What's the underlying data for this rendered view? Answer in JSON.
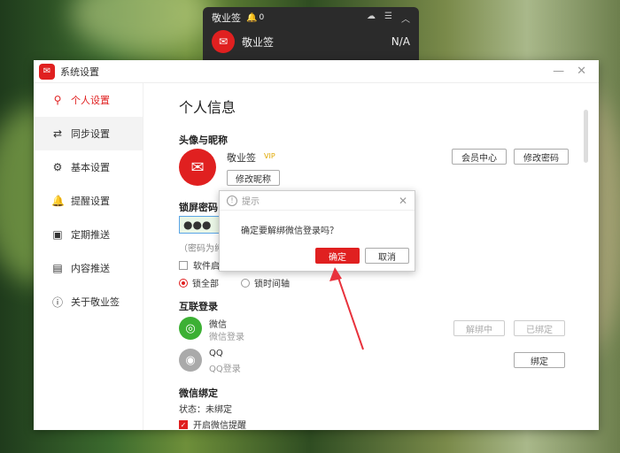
{
  "mini_widget": {
    "title": "敬业签",
    "bell_count": "0",
    "app_name": "敬业签",
    "value": "N/A"
  },
  "window": {
    "title": "系统设置"
  },
  "sidebar": {
    "items": [
      {
        "label": "个人设置",
        "icon": "person-icon"
      },
      {
        "label": "同步设置",
        "icon": "sync-icon"
      },
      {
        "label": "基本设置",
        "icon": "settings-icon"
      },
      {
        "label": "提醒设置",
        "icon": "bell-icon"
      },
      {
        "label": "定期推送",
        "icon": "calendar-icon"
      },
      {
        "label": "内容推送",
        "icon": "document-icon"
      },
      {
        "label": "关于敬业签",
        "icon": "info-icon"
      }
    ]
  },
  "content": {
    "heading": "个人信息",
    "avatar_section": "头像与昵称",
    "username": "敬业签",
    "vip": "VIP",
    "member_center": "会员中心",
    "change_password": "修改密码",
    "change_nickname": "修改昵称",
    "lock_section": "锁屏密码",
    "password_mask": "●●●",
    "password_hint": "（密码为纯",
    "software_start": "软件启",
    "lock_all": "锁全部",
    "lock_timeline": "锁时间轴",
    "interconnect_section": "互联登录",
    "wechat_name": "微信",
    "wechat_sub": "微信登录",
    "wechat_unbinding": "解绑中",
    "wechat_bound": "已绑定",
    "qq_name": "QQ",
    "qq_sub": "QQ登录",
    "qq_bind": "绑定",
    "wechat_bind_section": "微信绑定",
    "status": "状态：未绑定",
    "enable_reminder": "开启微信提醒"
  },
  "dialog": {
    "title": "提示",
    "message": "确定要解绑微信登录吗？",
    "ok": "确定",
    "cancel": "取消"
  },
  "colors": {
    "accent": "#e02020",
    "wechat": "#3cb034",
    "qq": "#aaaaaa"
  }
}
